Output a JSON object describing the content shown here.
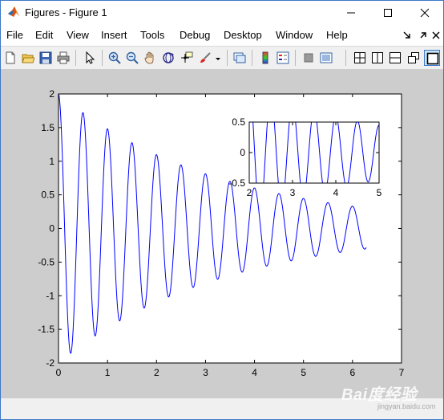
{
  "window": {
    "title": "Figures - Figure 1",
    "controls": {
      "minimize": "minimize",
      "maximize": "maximize",
      "close": "close"
    }
  },
  "menu": [
    "File",
    "Edit",
    "View",
    "Insert",
    "Tools",
    "Debug",
    "Desktop",
    "Window",
    "Help"
  ],
  "toolbar": {
    "icons": [
      "new-figure-icon",
      "open-file-icon",
      "save-icon",
      "print-icon",
      "pointer-icon",
      "zoom-in-icon",
      "zoom-out-icon",
      "pan-hand-icon",
      "rotate-3d-icon",
      "data-cursor-icon",
      "brush-icon",
      "link-plot-icon",
      "colorbar-icon",
      "legend-icon",
      "hide-plot-tools-icon",
      "show-plot-tools-icon",
      "tile-grid-icon",
      "tile-left-right-icon",
      "tile-top-bottom-icon",
      "float-icon",
      "maximize-figure-icon"
    ]
  },
  "watermark": {
    "text": "Bai度经验",
    "sub": "jingyan.baidu.com"
  },
  "chart_data": [
    {
      "type": "line",
      "title": "",
      "xlabel": "",
      "ylabel": "",
      "xlim": [
        0,
        7
      ],
      "ylim": [
        -2,
        2
      ],
      "xticks": [
        "0",
        "1",
        "2",
        "3",
        "4",
        "5",
        "6",
        "7"
      ],
      "yticks": [
        "2",
        "1.5",
        "1",
        "0.5",
        "0",
        "-0.5",
        "-1",
        "-1.5",
        "-2"
      ],
      "series": [
        {
          "function": "y = 2*exp(-0.3*x)*cos(2*pi*x/0.5)",
          "x_range": [
            0,
            6.28
          ],
          "color": "#0000ff"
        }
      ]
    },
    {
      "type": "line",
      "title": "",
      "xlabel": "",
      "ylabel": "",
      "xlim": [
        2,
        5
      ],
      "ylim": [
        -0.5,
        0.5
      ],
      "xticks": [
        "2",
        "3",
        "4",
        "5"
      ],
      "yticks": [
        "0.5",
        "0",
        "-0.5"
      ],
      "series": [
        {
          "function": "y = 2*exp(-0.3*x)*cos(2*pi*x/0.5)",
          "x_range": [
            2,
            5
          ],
          "color": "#0000ff"
        }
      ]
    }
  ]
}
